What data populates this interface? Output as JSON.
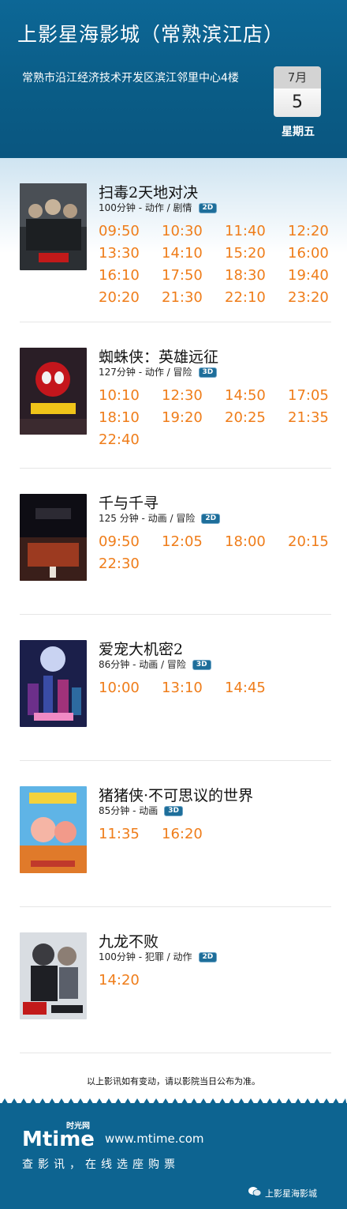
{
  "header": {
    "title": "上影星海影城（常熟滨江店）",
    "address": "常熟市沿江经济技术开发区滨江邻里中心4楼",
    "date_month": "7月",
    "date_day": "5",
    "weekday": "星期五"
  },
  "movies": [
    {
      "title": "扫毒2天地对决",
      "meta": "100分钟 - 动作 / 剧情",
      "format": "2D",
      "showtimes": [
        "09:50",
        "10:30",
        "11:40",
        "12:20",
        "13:30",
        "14:10",
        "15:20",
        "16:00",
        "16:10",
        "17:50",
        "18:30",
        "19:40",
        "20:20",
        "21:30",
        "22:10",
        "23:20"
      ]
    },
    {
      "title": "蜘蛛侠：英雄远征",
      "meta": "127分钟 - 动作 / 冒险",
      "format": "3D",
      "showtimes": [
        "10:10",
        "12:30",
        "14:50",
        "17:05",
        "18:10",
        "19:20",
        "20:25",
        "21:35",
        "22:40"
      ]
    },
    {
      "title": "千与千寻",
      "meta": "125 分钟 - 动画 / 冒险",
      "format": "2D",
      "showtimes": [
        "09:50",
        "12:05",
        "18:00",
        "20:15",
        "22:30"
      ]
    },
    {
      "title": "爱宠大机密2",
      "meta": "86分钟 - 动画 / 冒险",
      "format": "3D",
      "showtimes": [
        "10:00",
        "13:10",
        "14:45"
      ]
    },
    {
      "title": "猪猪侠·不可思议的世界",
      "meta": "85分钟 - 动画",
      "format": "3D",
      "showtimes": [
        "11:35",
        "16:20"
      ]
    },
    {
      "title": "九龙不败",
      "meta": "100分钟 - 犯罪 / 动作",
      "format": "2D",
      "showtimes": [
        "14:20"
      ]
    }
  ],
  "notice": "以上影讯如有变动，请以影院当日公布为准。",
  "footer": {
    "logo_text": "Mtime",
    "logo_cn": "时光网",
    "site": "www.mtime.com",
    "slogan": "查影讯，在线选座购票",
    "wechat_account": "上影星海影城"
  },
  "colors": {
    "header_blue": "#0d6796",
    "time_orange": "#ef7d1a",
    "badge_blue": "#1e6e9a"
  }
}
